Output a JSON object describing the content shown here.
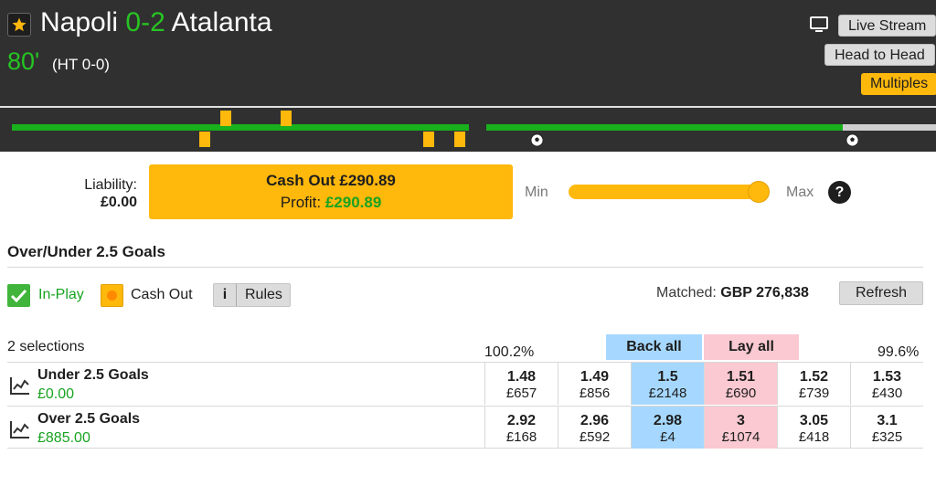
{
  "header": {
    "home": "Napoli",
    "score": "0-2",
    "away": "Atalanta",
    "minute": "80'",
    "half_time": "(HT 0-0)",
    "buttons": {
      "live_stream": "Live Stream",
      "head_to_head": "Head to Head",
      "multiples": "Multiples"
    }
  },
  "cashout": {
    "liability_label": "Liability:",
    "liability_value": "£0.00",
    "title": "Cash Out £290.89",
    "profit_label": "Profit:",
    "profit_value": "£290.89",
    "min_label": "Min",
    "max_label": "Max",
    "help_icon": "?",
    "slider_position": 1.0
  },
  "market": {
    "title": "Over/Under 2.5 Goals",
    "in_play": "In-Play",
    "cash_out": "Cash Out",
    "rules_icon": "i",
    "rules": "Rules",
    "matched_label": "Matched:",
    "matched_value": "GBP 276,838",
    "refresh": "Refresh",
    "selections_count": "2 selections",
    "back_book": "100.2%",
    "lay_book": "99.6%",
    "back_all": "Back all",
    "lay_all": "Lay all",
    "runners": [
      {
        "name": "Under 2.5 Goals",
        "pl": "£0.00",
        "prices": [
          {
            "price": "1.48",
            "size": "£657"
          },
          {
            "price": "1.49",
            "size": "£856"
          },
          {
            "price": "1.5",
            "size": "£2148"
          },
          {
            "price": "1.51",
            "size": "£690"
          },
          {
            "price": "1.52",
            "size": "£739"
          },
          {
            "price": "1.53",
            "size": "£430"
          }
        ]
      },
      {
        "name": "Over 2.5 Goals",
        "pl": "£885.00",
        "prices": [
          {
            "price": "2.92",
            "size": "£168"
          },
          {
            "price": "2.96",
            "size": "£592"
          },
          {
            "price": "2.98",
            "size": "£4"
          },
          {
            "price": "3",
            "size": "£1074"
          },
          {
            "price": "3.05",
            "size": "£418"
          },
          {
            "price": "3.1",
            "size": "£325"
          }
        ]
      }
    ]
  },
  "colors": {
    "accent_yellow": "#ffb80c",
    "in_play_green": "#27c423",
    "back_blue": "#a6d8ff",
    "lay_pink": "#fac9d1",
    "header_bg": "#303030"
  },
  "icons": [
    "star-icon",
    "tv-icon",
    "yellow-card-icon",
    "goal-ball-icon",
    "checkmark-icon",
    "cash-out-dot-icon",
    "info-icon",
    "help-icon",
    "market-chart-icon"
  ]
}
